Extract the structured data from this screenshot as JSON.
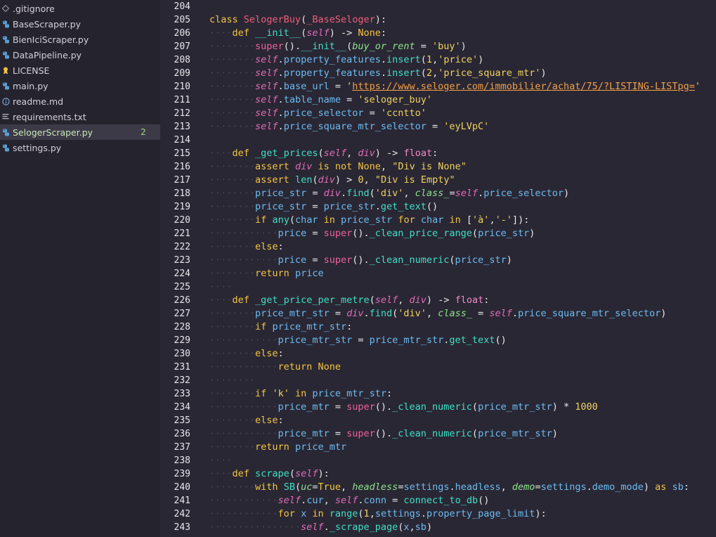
{
  "sidebar": {
    "files": [
      {
        "name": ".gitignore",
        "icon": "diamond-icon"
      },
      {
        "name": "BaseScraper.py",
        "icon": "python-icon"
      },
      {
        "name": "BienIciScraper.py",
        "icon": "python-icon"
      },
      {
        "name": "DataPipeline.py",
        "icon": "python-icon"
      },
      {
        "name": "LICENSE",
        "icon": "license-icon"
      },
      {
        "name": "main.py",
        "icon": "python-icon"
      },
      {
        "name": "readme.md",
        "icon": "info-icon"
      },
      {
        "name": "requirements.txt",
        "icon": "text-file-icon"
      },
      {
        "name": "SelogerScraper.py",
        "icon": "python-icon",
        "badge": "2",
        "active": true
      },
      {
        "name": "settings.py",
        "icon": "python-icon"
      }
    ]
  },
  "editor": {
    "line_numbers": [
      "204",
      "205",
      "206",
      "207",
      "208",
      "209",
      "210",
      "211",
      "212",
      "213",
      "214",
      "215",
      "216",
      "217",
      "218",
      "219",
      "220",
      "221",
      "222",
      "223",
      "224",
      "225",
      "226",
      "227",
      "228",
      "229",
      "230",
      "231",
      "232",
      "233",
      "234",
      "235",
      "236",
      "237",
      "238",
      "239",
      "240",
      "241",
      "242",
      "243"
    ]
  },
  "colors": {
    "background": "#2a2734",
    "sidebar": "#25232e",
    "active_row": "#3d3a48"
  }
}
